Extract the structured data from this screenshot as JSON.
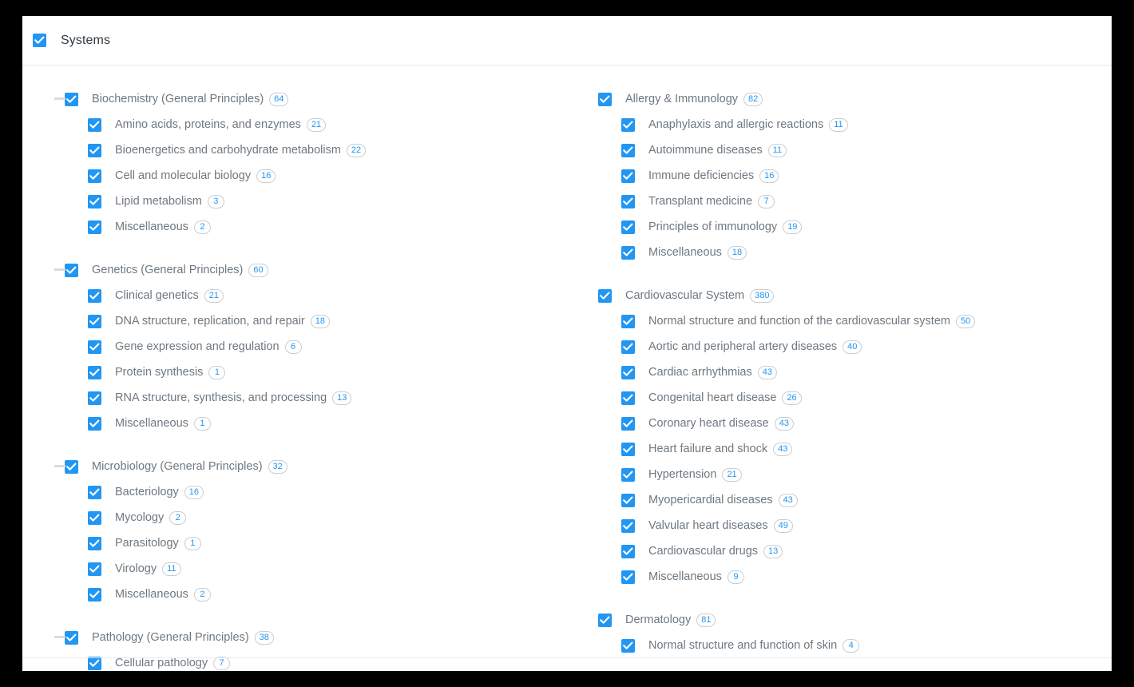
{
  "header": {
    "title": "Systems",
    "checked": true
  },
  "icons": {
    "check": "check-icon",
    "collapse": "minus-collapse-icon"
  },
  "colors": {
    "accent": "#2196f3",
    "label_text": "#6e7880",
    "header_text": "#333a41",
    "badge_border": "#c9ced3",
    "divider": "#e8eaec",
    "collapse_icon": "#dedbd4",
    "page_background": "#000000",
    "card_background": "#ffffff"
  },
  "columns": {
    "left": [
      {
        "label": "Biochemistry (General Principles)",
        "count": "64",
        "collapsible": true,
        "children": [
          {
            "label": "Amino acids, proteins, and enzymes",
            "count": "21"
          },
          {
            "label": "Bioenergetics and carbohydrate metabolism",
            "count": "22"
          },
          {
            "label": "Cell and molecular biology",
            "count": "16"
          },
          {
            "label": "Lipid metabolism",
            "count": "3"
          },
          {
            "label": "Miscellaneous",
            "count": "2"
          }
        ]
      },
      {
        "label": "Genetics (General Principles)",
        "count": "60",
        "collapsible": true,
        "children": [
          {
            "label": "Clinical genetics",
            "count": "21"
          },
          {
            "label": "DNA structure, replication, and repair",
            "count": "18"
          },
          {
            "label": "Gene expression and regulation",
            "count": "6"
          },
          {
            "label": "Protein synthesis",
            "count": "1"
          },
          {
            "label": "RNA structure, synthesis, and processing",
            "count": "13"
          },
          {
            "label": "Miscellaneous",
            "count": "1"
          }
        ]
      },
      {
        "label": "Microbiology (General Principles)",
        "count": "32",
        "collapsible": true,
        "children": [
          {
            "label": "Bacteriology",
            "count": "16"
          },
          {
            "label": "Mycology",
            "count": "2"
          },
          {
            "label": "Parasitology",
            "count": "1"
          },
          {
            "label": "Virology",
            "count": "11"
          },
          {
            "label": "Miscellaneous",
            "count": "2"
          }
        ]
      },
      {
        "label": "Pathology (General Principles)",
        "count": "38",
        "collapsible": true,
        "children": [
          {
            "label": "Cellular pathology",
            "count": "7"
          }
        ]
      }
    ],
    "right": [
      {
        "label": "Allergy & Immunology",
        "count": "82",
        "collapsible": false,
        "children": [
          {
            "label": "Anaphylaxis and allergic reactions",
            "count": "11"
          },
          {
            "label": "Autoimmune diseases",
            "count": "11"
          },
          {
            "label": "Immune deficiencies",
            "count": "16"
          },
          {
            "label": "Transplant medicine",
            "count": "7"
          },
          {
            "label": "Principles of immunology",
            "count": "19"
          },
          {
            "label": "Miscellaneous",
            "count": "18"
          }
        ]
      },
      {
        "label": "Cardiovascular System",
        "count": "380",
        "collapsible": false,
        "children": [
          {
            "label": "Normal structure and function of the cardiovascular system",
            "count": "50"
          },
          {
            "label": "Aortic and peripheral artery diseases",
            "count": "40"
          },
          {
            "label": "Cardiac arrhythmias",
            "count": "43"
          },
          {
            "label": "Congenital heart disease",
            "count": "26"
          },
          {
            "label": "Coronary heart disease",
            "count": "43"
          },
          {
            "label": "Heart failure and shock",
            "count": "43"
          },
          {
            "label": "Hypertension",
            "count": "21"
          },
          {
            "label": "Myopericardial diseases",
            "count": "43"
          },
          {
            "label": "Valvular heart diseases",
            "count": "49"
          },
          {
            "label": "Cardiovascular drugs",
            "count": "13"
          },
          {
            "label": "Miscellaneous",
            "count": "9"
          }
        ]
      },
      {
        "label": "Dermatology",
        "count": "81",
        "collapsible": false,
        "children": [
          {
            "label": "Normal structure and function of skin",
            "count": "4"
          }
        ]
      }
    ]
  }
}
